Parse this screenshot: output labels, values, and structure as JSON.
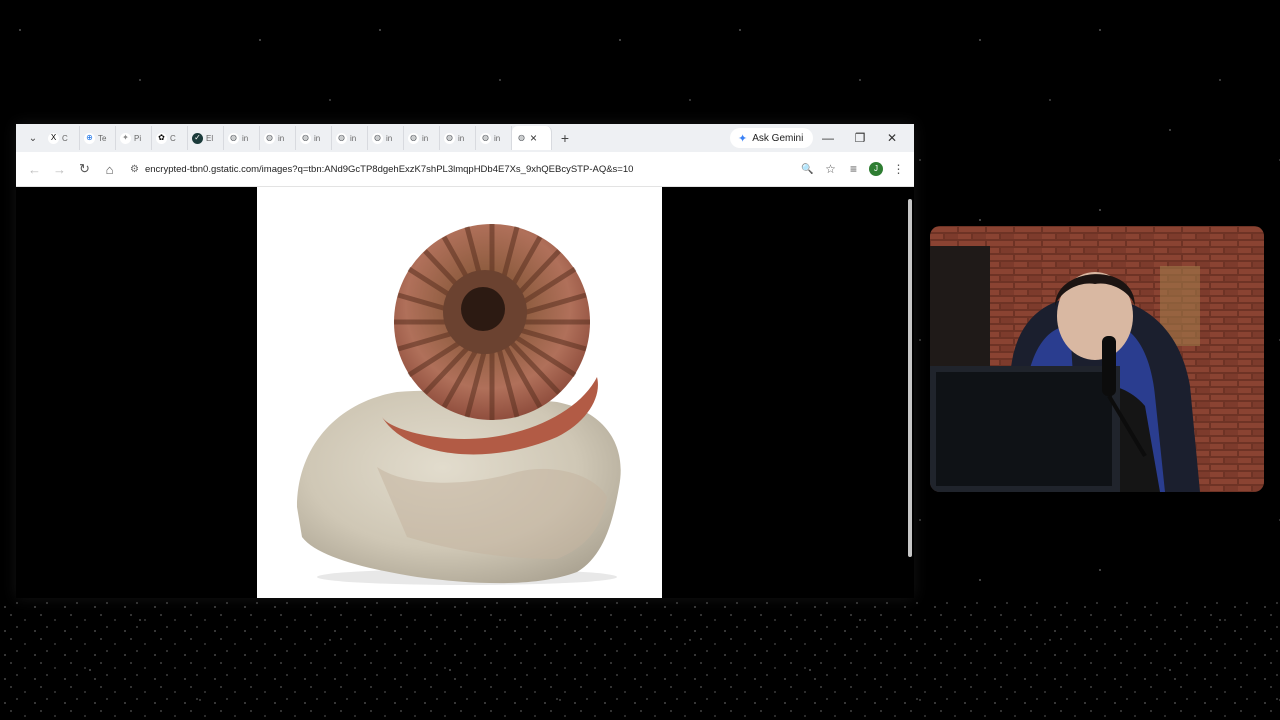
{
  "browser": {
    "tabs": [
      {
        "fav": "X",
        "label": "C",
        "fav_bg": "#ffffff",
        "fav_color": "#000000"
      },
      {
        "fav": "⊕",
        "label": "Te",
        "fav_bg": "#ffffff",
        "fav_color": "#1a73e8"
      },
      {
        "fav": "✦",
        "label": "Pi",
        "fav_bg": "#ffffff",
        "fav_color": "#888888"
      },
      {
        "fav": "✿",
        "label": "C",
        "fav_bg": "#ffffff",
        "fav_color": "#000000"
      },
      {
        "fav": "✓",
        "label": "El",
        "fav_bg": "#1b3a3a",
        "fav_color": "#ffffff"
      },
      {
        "fav": "◍",
        "label": "in",
        "fav_bg": "#ffffff",
        "fav_color": "#5f6368"
      },
      {
        "fav": "◍",
        "label": "in",
        "fav_bg": "#ffffff",
        "fav_color": "#5f6368"
      },
      {
        "fav": "◍",
        "label": "in",
        "fav_bg": "#ffffff",
        "fav_color": "#5f6368"
      },
      {
        "fav": "◍",
        "label": "in",
        "fav_bg": "#ffffff",
        "fav_color": "#5f6368"
      },
      {
        "fav": "◍",
        "label": "in",
        "fav_bg": "#ffffff",
        "fav_color": "#5f6368"
      },
      {
        "fav": "◍",
        "label": "in",
        "fav_bg": "#ffffff",
        "fav_color": "#5f6368"
      },
      {
        "fav": "◍",
        "label": "in",
        "fav_bg": "#ffffff",
        "fav_color": "#5f6368"
      },
      {
        "fav": "◍",
        "label": "in",
        "fav_bg": "#ffffff",
        "fav_color": "#5f6368"
      }
    ],
    "active_tab": {
      "fav": "◍",
      "close": "×"
    },
    "new_tab": "+",
    "ask_gemini": "Ask Gemini",
    "url": "encrypted-tbn0.gstatic.com/images?q=tbn:ANd9GcTP8dgehExzK7shPL3lmqpHDb4E7Xs_9xhQEBcySTP-AQ&s=10",
    "avatar_letter": "J"
  },
  "icons": {
    "tab_search": "⌄",
    "minimize": "—",
    "restore": "❐",
    "close_window": "✕",
    "back": "←",
    "forward": "→",
    "reload": "↻",
    "home": "⌂",
    "site_info": "⚙",
    "zoom": "🔍",
    "bookmark": "☆",
    "tab_groups": "≡",
    "menu": "⋮"
  },
  "colors": {
    "accent_gemini": "#3b82f6",
    "avatar_bg": "#2e7d32"
  }
}
